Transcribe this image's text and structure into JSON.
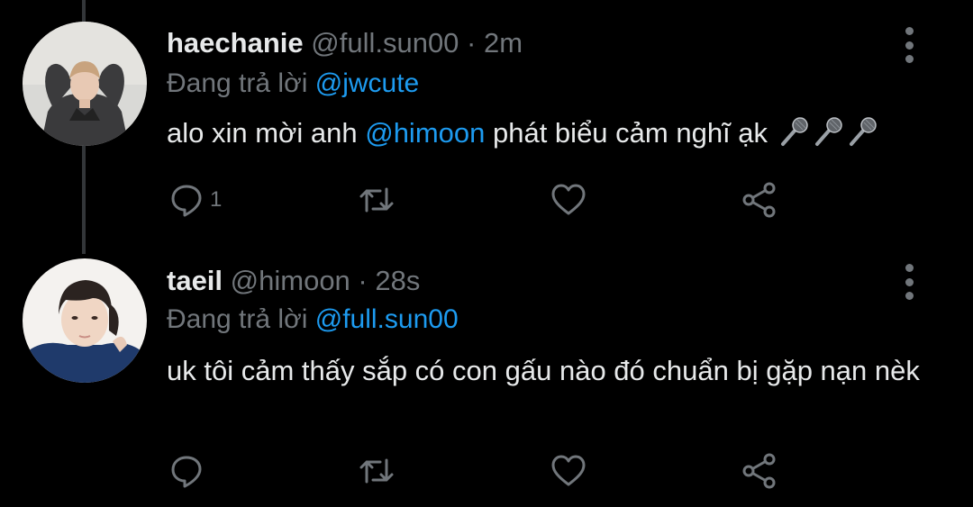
{
  "tweets": [
    {
      "name": "haechanie",
      "handle": "@full.sun00",
      "separator": " · ",
      "time": "2m",
      "replying_prefix": "Đang trả lời ",
      "replying_to": "@jwcute",
      "text_before": "alo xin mời anh ",
      "text_mention": "@himoon",
      "text_after": " phát biểu cảm nghĩ ạk ",
      "emoji": [
        "microphone",
        "microphone",
        "microphone"
      ],
      "reply_count": "1",
      "icons": {
        "reply": "reply-icon",
        "retweet": "retweet-icon",
        "like": "like-icon",
        "share": "share-icon",
        "more": "more-vertical-icon"
      }
    },
    {
      "name": "taeil",
      "handle": "@himoon",
      "separator": " · ",
      "time": "28s",
      "replying_prefix": "Đang trả lời ",
      "replying_to": "@full.sun00",
      "text": "uk tôi cảm thấy sắp có con gấu nào đó chuẩn bị gặp nạn nèk",
      "reply_count": "",
      "icons": {
        "reply": "reply-icon",
        "retweet": "retweet-icon",
        "like": "like-icon",
        "share": "share-icon",
        "more": "more-vertical-icon"
      }
    }
  ],
  "colors": {
    "background": "#000000",
    "text": "#e7e9ea",
    "muted": "#71767b",
    "link": "#1d9bf0",
    "thread_line": "#333639"
  }
}
